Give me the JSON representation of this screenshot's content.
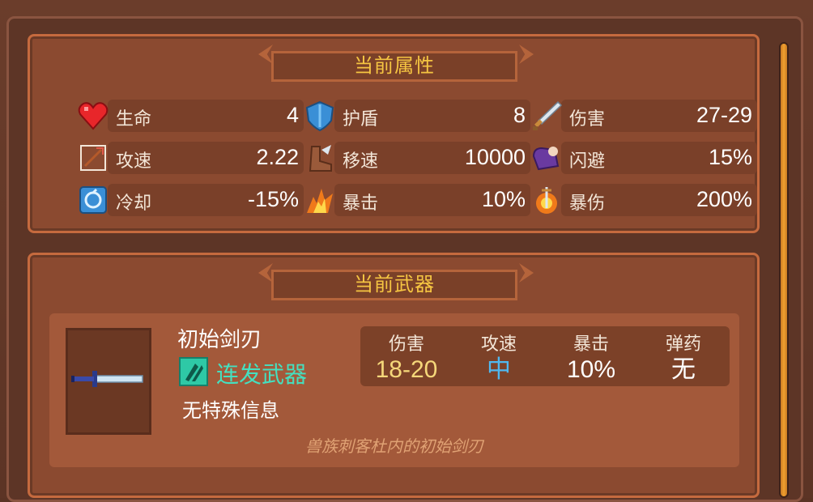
{
  "attributes": {
    "title": "当前属性",
    "stats": [
      {
        "label": "生命",
        "value": "4",
        "icon": "heart-icon"
      },
      {
        "label": "护盾",
        "value": "8",
        "icon": "shield-icon"
      },
      {
        "label": "伤害",
        "value": "27-29",
        "icon": "sword-icon"
      },
      {
        "label": "攻速",
        "value": "2.22",
        "icon": "attack-speed-icon"
      },
      {
        "label": "移速",
        "value": "10000",
        "icon": "boot-icon"
      },
      {
        "label": "闪避",
        "value": "15%",
        "icon": "dodge-icon"
      },
      {
        "label": "冷却",
        "value": "-15%",
        "icon": "cooldown-icon"
      },
      {
        "label": "暴击",
        "value": "10%",
        "icon": "critical-icon"
      },
      {
        "label": "暴伤",
        "value": "200%",
        "icon": "crit-damage-icon"
      }
    ]
  },
  "weapon": {
    "title": "当前武器",
    "name": "初始剑刃",
    "type": "连发武器",
    "info": "无特殊信息",
    "description": "兽族刺客杜内的初始剑刃",
    "stats": [
      {
        "label": "伤害",
        "value": "18-20",
        "color": "#f5d77a"
      },
      {
        "label": "攻速",
        "value": "中",
        "color": "#4fb8f0"
      },
      {
        "label": "暴击",
        "value": "10%",
        "color": "#ffffff"
      },
      {
        "label": "弹药",
        "value": "无",
        "color": "#ffffff"
      }
    ]
  },
  "colors": {
    "title_gold": "#f5c542",
    "weapon_type_teal": "#44e0c0",
    "scroll_orange": "#f0a030"
  }
}
